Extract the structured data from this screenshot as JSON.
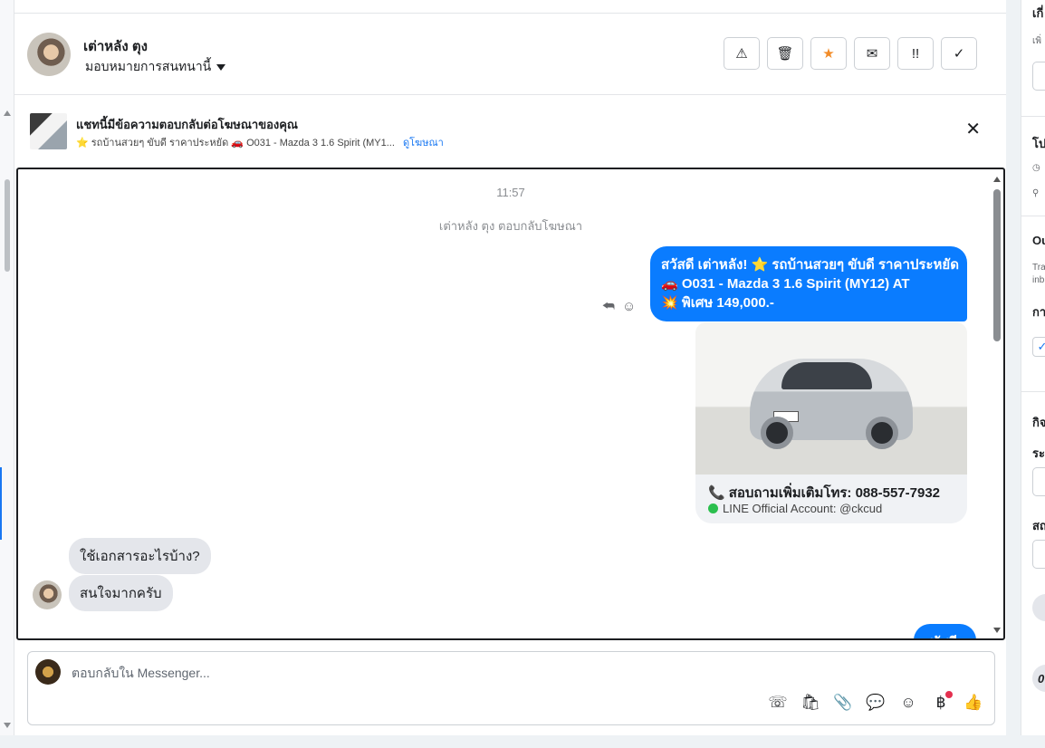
{
  "header": {
    "name": "เต่าหลัง ตุง",
    "assign_label": "มอบหมายการสนทนานี้",
    "actions": [
      {
        "icon": "⚠",
        "name": "warning-icon"
      },
      {
        "icon": "🗑",
        "name": "trash-icon"
      },
      {
        "icon": "★",
        "name": "star-icon"
      },
      {
        "icon": "✉",
        "name": "mail-icon"
      },
      {
        "icon": "!!",
        "name": "urgent-icon"
      },
      {
        "icon": "✓",
        "name": "check-icon"
      }
    ]
  },
  "ad_banner": {
    "title": "แชทนี้มีข้อความตอบกลับต่อโฆษณาของคุณ",
    "subtitle": "⭐ รถบ้านสวยๆ ขับดี ราคาประหยัด 🚗 O031 - Mazda 3 1.6 Spirit (MY1...",
    "link": "ดูโฆษณา",
    "close": "✕"
  },
  "chat": {
    "time": "11:57",
    "note": "เต่าหลัง ตุง ตอบกลับโฆษณา",
    "outgoing_lines": [
      "สวัสดี เต่าหลัง! ⭐ รถบ้านสวยๆ ขับดี ราคาประหยัด",
      "🚗 O031 - Mazda 3 1.6 Spirit (MY12) AT",
      "💥 พิเศษ 149,000.-"
    ],
    "card_line1": "สอบถามเพิ่มเติมโทร: 088-557-7932",
    "card_phone_icon": "📞",
    "card_line2": "LINE Official Account: @ckcud",
    "incoming": [
      "ใช้เอกสารอะไรบ้าง?",
      "สนใจมากครับ"
    ],
    "outgoing_partial": "สวัสดีอ"
  },
  "composer": {
    "placeholder": "ตอบกลับใน Messenger...",
    "tools": [
      {
        "icon": "☏",
        "name": "call-add-icon"
      },
      {
        "icon": "🛍",
        "name": "shopping-bag-icon"
      },
      {
        "icon": "📎",
        "name": "attachment-icon"
      },
      {
        "icon": "💬",
        "name": "saved-reply-icon"
      },
      {
        "icon": "☺",
        "name": "emoji-icon"
      },
      {
        "icon": "฿",
        "name": "baht-icon"
      },
      {
        "icon": "👍",
        "name": "like-icon"
      }
    ]
  },
  "right_panel": {
    "t1": "เกี่",
    "t2": "เพิ่",
    "t3": "โป",
    "t4": "Ou",
    "t5": "Tra",
    "t6": "inb",
    "t7": "กา",
    "t8": "กิจ",
    "t9": "ระ",
    "t10": "สถ",
    "t11": "0"
  }
}
